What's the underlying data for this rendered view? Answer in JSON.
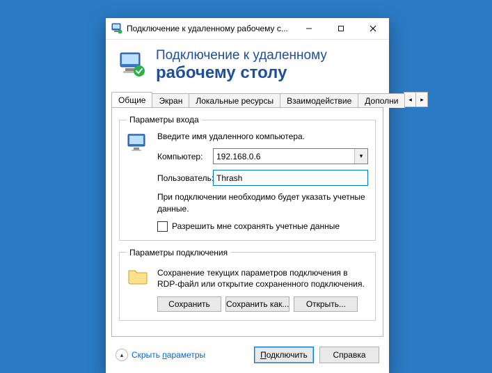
{
  "titlebar": {
    "title": "Подключение к удаленному рабочему с..."
  },
  "header": {
    "line1": "Подключение к удаленному",
    "line2": "рабочему столу"
  },
  "tabs": {
    "items": [
      "Общие",
      "Экран",
      "Локальные ресурсы",
      "Взаимодействие",
      "Дополни"
    ],
    "active_index": 0
  },
  "login_group": {
    "legend": "Параметры входа",
    "instruction": "Введите имя удаленного компьютера.",
    "computer_label": "Компьютер:",
    "computer_value": "192.168.0.6",
    "user_label": "Пользователь:",
    "user_value": "Thrash",
    "note": "При подключении необходимо будет указать учетные данные.",
    "checkbox_label": "Разрешить мне сохранять учетные данные"
  },
  "conn_group": {
    "legend": "Параметры подключения",
    "note": "Сохранение текущих параметров подключения в RDP-файл или открытие сохраненного подключения.",
    "save_btn": "Сохранить",
    "save_as_btn": "Сохранить как...",
    "open_btn": "Открыть..."
  },
  "footer": {
    "hide_params": "Скрыть параметры",
    "connect_btn": "Подключить",
    "help_btn": "Справка"
  }
}
